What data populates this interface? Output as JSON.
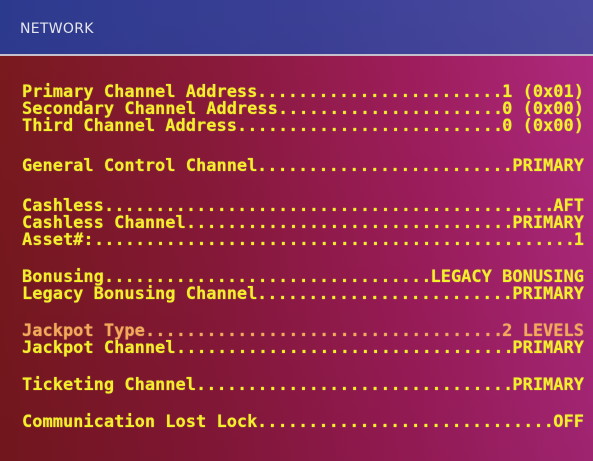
{
  "header": {
    "title": "NETWORK"
  },
  "groups": [
    {
      "rows": [
        {
          "label": "Primary Channel Address",
          "value": "1 (0x01)"
        },
        {
          "label": "Secondary Channel Address",
          "value": "0 (0x00)"
        },
        {
          "label": "Third Channel Address",
          "value": "0 (0x00)"
        }
      ]
    },
    {
      "rows": [
        {
          "label": "General Control Channel",
          "value": "PRIMARY"
        }
      ]
    },
    {
      "rows": [
        {
          "label": "Cashless",
          "value": "AFT"
        },
        {
          "label": "Cashless Channel",
          "value": "PRIMARY"
        },
        {
          "label": "Asset#:",
          "value": "1"
        }
      ]
    },
    {
      "rows": [
        {
          "label": "Bonusing",
          "value": "LEGACY BONUSING"
        },
        {
          "label": "Legacy Bonusing Channel",
          "value": "PRIMARY"
        }
      ]
    },
    {
      "rows": [
        {
          "label": "Jackpot Type",
          "value": "2 LEVELS",
          "highlight": true
        },
        {
          "label": "Jackpot Channel",
          "value": "PRIMARY"
        }
      ]
    },
    {
      "rows": [
        {
          "label": "Ticketing Channel",
          "value": "PRIMARY"
        }
      ]
    },
    {
      "rows": [
        {
          "label": "Communication Lost Lock",
          "value": "OFF"
        }
      ]
    }
  ],
  "colors": {
    "text": "#f3f02a",
    "highlight": "#f3a85c",
    "header_bg": "#3a3f95",
    "body_bg": "#a01e5e"
  }
}
